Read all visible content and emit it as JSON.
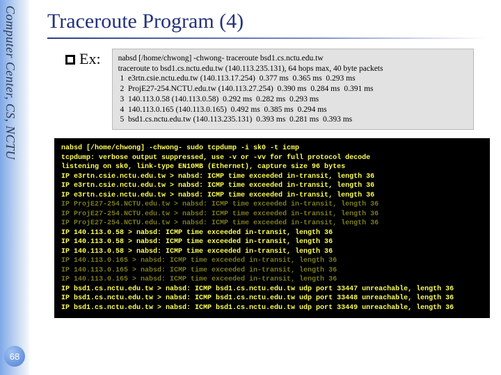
{
  "rail": {
    "text": "Computer Center, CS, NCTU"
  },
  "page_number": "68",
  "title": "Traceroute Program (4)",
  "example_label": "Ex:",
  "trace": {
    "lines": [
      "nabsd [/home/chwong] -chwong- traceroute bsd1.cs.nctu.edu.tw",
      "traceroute to bsd1.cs.nctu.edu.tw (140.113.235.131), 64 hops max, 40 byte packets",
      " 1  e3rtn.csie.nctu.edu.tw (140.113.17.254)  0.377 ms  0.365 ms  0.293 ms",
      " 2  ProjE27-254.NCTU.edu.tw (140.113.27.254)  0.390 ms  0.284 ms  0.391 ms",
      " 3  140.113.0.58 (140.113.0.58)  0.292 ms  0.282 ms  0.293 ms",
      " 4  140.113.0.165 (140.113.0.165)  0.492 ms  0.385 ms  0.294 ms",
      " 5  bsd1.cs.nctu.edu.tw (140.113.235.131)  0.393 ms  0.281 ms  0.393 ms"
    ]
  },
  "terminal": {
    "lines": [
      {
        "t": "nabsd [/home/chwong] -chwong- sudo tcpdump -i sk0 -t icmp",
        "faded": false
      },
      {
        "t": "tcpdump: verbose output suppressed, use -v or -vv for full protocol decode",
        "faded": false
      },
      {
        "t": "listening on sk0, link-type EN10MB (Ethernet), capture size 96 bytes",
        "faded": false
      },
      {
        "t": "IP e3rtn.csie.nctu.edu.tw > nabsd: ICMP time exceeded in-transit, length 36",
        "faded": false
      },
      {
        "t": "IP e3rtn.csie.nctu.edu.tw > nabsd: ICMP time exceeded in-transit, length 36",
        "faded": false
      },
      {
        "t": "IP e3rtn.csie.nctu.edu.tw > nabsd: ICMP time exceeded in-transit, length 36",
        "faded": false
      },
      {
        "t": "IP ProjE27-254.NCTU.edu.tw > nabsd: ICMP time exceeded in-transit, length 36",
        "faded": true
      },
      {
        "t": "IP ProjE27-254.NCTU.edu.tw > nabsd: ICMP time exceeded in-transit, length 36",
        "faded": true
      },
      {
        "t": "IP ProjE27-254.NCTU.edu.tw > nabsd: ICMP time exceeded in-transit, length 36",
        "faded": true
      },
      {
        "t": "IP 140.113.0.58 > nabsd: ICMP time exceeded in-transit, length 36",
        "faded": false
      },
      {
        "t": "IP 140.113.0.58 > nabsd: ICMP time exceeded in-transit, length 36",
        "faded": false
      },
      {
        "t": "IP 140.113.0.58 > nabsd: ICMP time exceeded in-transit, length 36",
        "faded": false
      },
      {
        "t": "IP 140.113.0.165 > nabsd: ICMP time exceeded in-transit, length 36",
        "faded": true
      },
      {
        "t": "IP 140.113.0.165 > nabsd: ICMP time exceeded in-transit, length 36",
        "faded": true
      },
      {
        "t": "IP 140.113.0.165 > nabsd: ICMP time exceeded in-transit, length 36",
        "faded": true
      },
      {
        "t": "IP bsd1.cs.nctu.edu.tw > nabsd: ICMP bsd1.cs.nctu.edu.tw udp port 33447 unreachable, length 36",
        "faded": false
      },
      {
        "t": "IP bsd1.cs.nctu.edu.tw > nabsd: ICMP bsd1.cs.nctu.edu.tw udp port 33448 unreachable, length 36",
        "faded": false
      },
      {
        "t": "IP bsd1.cs.nctu.edu.tw > nabsd: ICMP bsd1.cs.nctu.edu.tw udp port 33449 unreachable, length 36",
        "faded": false
      }
    ]
  }
}
